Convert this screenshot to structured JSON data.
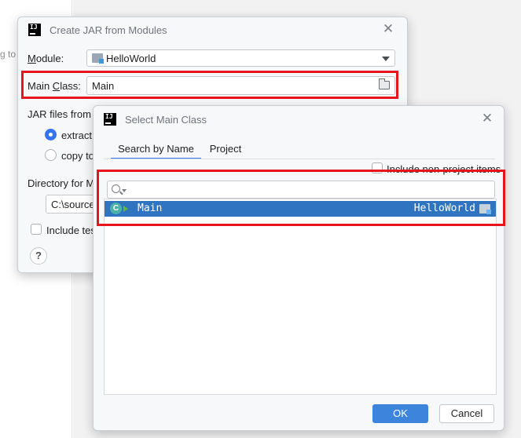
{
  "background": {
    "partial_text": "g to"
  },
  "create_jar_dialog": {
    "title": "Create JAR from Modules",
    "module_label": "Module:",
    "module_value": "HelloWorld",
    "main_class_label": "Main Class:",
    "main_class_value": "Main",
    "jar_files_label": "JAR files from li",
    "extract_option": "extract t",
    "copy_option": "copy to",
    "directory_label": "Directory for M",
    "directory_value": "C:\\source",
    "include_tests_label": "Include test",
    "help_label": "?"
  },
  "select_main_dialog": {
    "title": "Select Main Class",
    "tabs": [
      {
        "label": "Search by Name",
        "active": true
      },
      {
        "label": "Project",
        "active": false
      }
    ],
    "include_non_project_label": "Include non-project items",
    "search_value": "",
    "results": [
      {
        "name": "Main",
        "module": "HelloWorld",
        "selected": true
      }
    ],
    "ok_label": "OK",
    "cancel_label": "Cancel"
  },
  "colors": {
    "highlight": "#e8141b",
    "selection": "#2f74c0",
    "primary_button": "#3d85dc",
    "accent": "#3574f0"
  }
}
